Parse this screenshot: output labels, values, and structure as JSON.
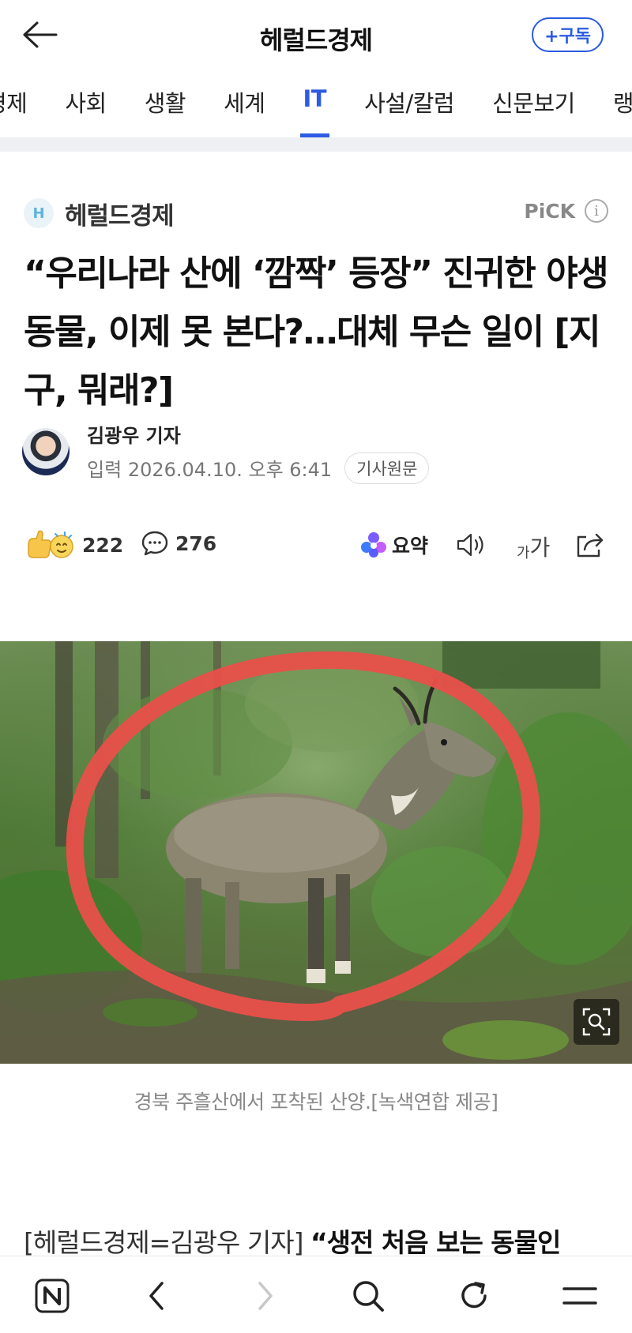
{
  "header": {
    "title": "헤럴드경제",
    "subscribe_label": "+구독"
  },
  "categories": [
    {
      "label": "경제",
      "active": false
    },
    {
      "label": "사회",
      "active": false
    },
    {
      "label": "생활",
      "active": false
    },
    {
      "label": "세계",
      "active": false
    },
    {
      "label": "IT",
      "active": true
    },
    {
      "label": "사설/칼럼",
      "active": false
    },
    {
      "label": "신문보기",
      "active": false
    },
    {
      "label": "랭",
      "active": false
    }
  ],
  "press": {
    "logo_letter": "H",
    "name": "헤럴드경제",
    "pick_label": "PiCK",
    "info_glyph": "i"
  },
  "article": {
    "headline": "“우리나라 산에 ‘깜짝’ 등장” 진귀한 야생동물, 이제 못 본다?…대체 무슨 일이 [지구, 뭐래?]",
    "reporter": "김광우 기자",
    "date_prefix": "입력",
    "date": "2026.04.10. 오후 6:41",
    "original_button": "기사원문",
    "photo_caption": "경북 주흘산에서 포착된 산양.[녹색연합 제공]",
    "body_lead": "[헤럴드경제=김광우 기자] ",
    "body_bold": "“생전 처음 보는 동물인"
  },
  "actions": {
    "reaction_count": "222",
    "comment_count": "276",
    "summary_label": "요약",
    "font_small": "가",
    "font_big": "가"
  },
  "colors": {
    "accent": "#2d5be3",
    "circle_annotation": "#e8504a"
  },
  "bottom_nav": [
    {
      "icon": "naver-home-icon"
    },
    {
      "icon": "back-arrow-icon"
    },
    {
      "icon": "forward-arrow-icon"
    },
    {
      "icon": "search-icon"
    },
    {
      "icon": "refresh-icon"
    },
    {
      "icon": "menu-icon"
    }
  ]
}
